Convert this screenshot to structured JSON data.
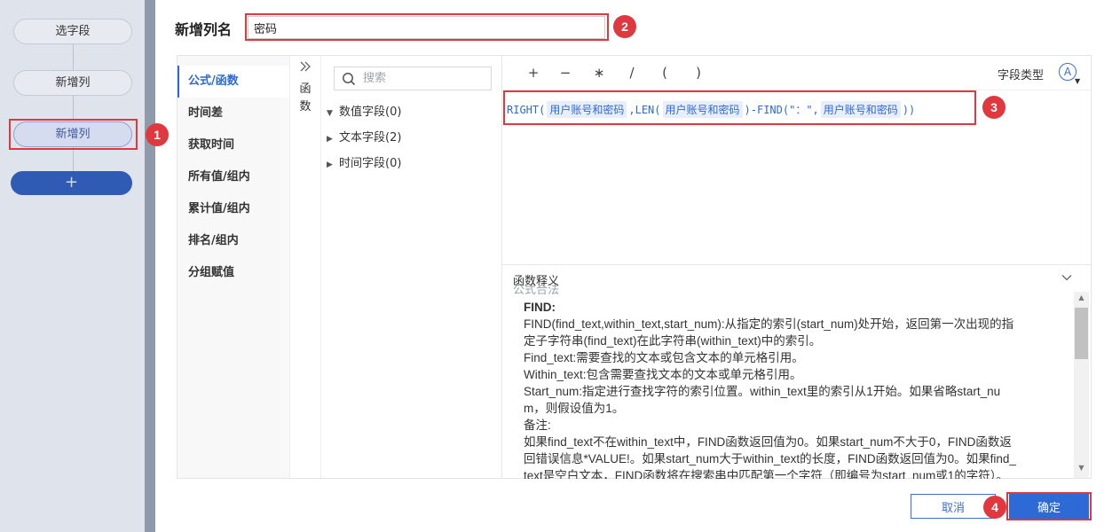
{
  "sidebar": {
    "steps": [
      {
        "label": "选字段"
      },
      {
        "label": "新增列"
      },
      {
        "label": "新增列"
      }
    ],
    "add_label": "+"
  },
  "header": {
    "col_name_label": "新增列名",
    "col_name_value": "密码"
  },
  "categories": [
    {
      "label": "公式/函数",
      "active": true
    },
    {
      "label": "时间差"
    },
    {
      "label": "获取时间"
    },
    {
      "label": "所有值/组内"
    },
    {
      "label": "累计值/组内"
    },
    {
      "label": "排名/组内"
    },
    {
      "label": "分组赋值"
    }
  ],
  "collapse": {
    "icon": "double-chevron-right-icon",
    "text": "函数"
  },
  "fields": {
    "search_placeholder": "搜索",
    "nodes": [
      {
        "caret": "▼",
        "label": "数值字段(0)"
      },
      {
        "caret": "▶",
        "label": "文本字段(2)"
      },
      {
        "caret": "▶",
        "label": "时间字段(0)"
      }
    ]
  },
  "toolbar": {
    "operators": [
      "+",
      "−",
      "∗",
      "/",
      "(",
      ")"
    ],
    "field_type_label": "字段类型",
    "field_type_icon": "A"
  },
  "formula": {
    "p1": "RIGHT(",
    "t1": "用户账号和密码",
    "p2": ",LEN(",
    "t2": "用户账号和密码",
    "p3": ")-FIND(\"：\",",
    "t3": "用户账号和密码",
    "p4": "))",
    "valid_text": "公式合法"
  },
  "explain": {
    "title": "函数释义",
    "lines": [
      "FIND:",
      "FIND(find_text,within_text,start_num):从指定的索引(start_num)处开始，返回第一次出现的指",
      "定子字符串(find_text)在此字符串(within_text)中的索引。",
      "Find_text:需要查找的文本或包含文本的单元格引用。",
      "Within_text:包含需要查找文本的文本或单元格引用。",
      "Start_num:指定进行查找字符的索引位置。within_text里的索引从1开始。如果省略start_nu",
      "m，则假设值为1。",
      "备注:",
      "如果find_text不在within_text中，FIND函数返回值为0。如果start_num不大于0，FIND函数返",
      "回错误信息*VALUE!。如果start_num大于within_text的长度，FIND函数返回值为0。如果find_",
      "text是空白文本，FIND函数将在搜索串中匹配第一个字符（即编号为start_num或1的字符）。"
    ]
  },
  "footer": {
    "cancel_label": "取消",
    "ok_label": "确定"
  },
  "annotations": [
    "1",
    "2",
    "3",
    "4"
  ],
  "colors": {
    "accent": "#2d6ad5",
    "highlight": "#e0383e"
  }
}
